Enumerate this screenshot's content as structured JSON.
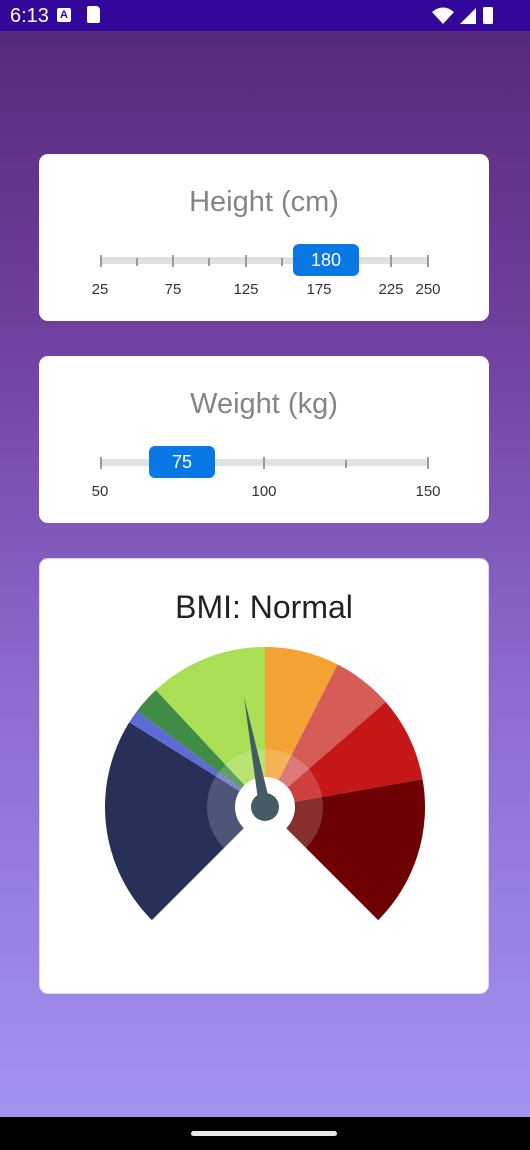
{
  "status_bar": {
    "time": "6:13",
    "icons": [
      "app-a-icon",
      "sd-card-icon",
      "wifi-icon",
      "signal-icon",
      "battery-icon"
    ]
  },
  "height_card": {
    "title": "Height (cm)",
    "value": "180",
    "min": 25,
    "max": 250,
    "tick_labels": [
      "25",
      "75",
      "125",
      "175",
      "225",
      "250"
    ]
  },
  "weight_card": {
    "title": "Weight (kg)",
    "value": "75",
    "min": 50,
    "max": 150,
    "tick_labels": [
      "50",
      "100",
      "150"
    ]
  },
  "bmi_card": {
    "title": "BMI: Normal",
    "gauge_colors": [
      "#283058",
      "#5d6bd4",
      "#3e8c45",
      "#aade55",
      "#f4a233",
      "#d65c58",
      "#c51717",
      "#6d0000"
    ],
    "needle_color": "#455a64"
  },
  "colors": {
    "accent": "#0a78e4",
    "status_bar": "#32079a"
  }
}
